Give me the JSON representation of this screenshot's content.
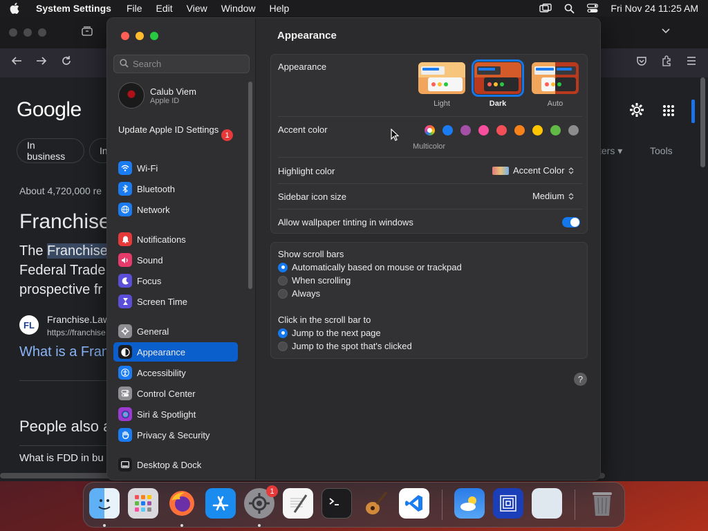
{
  "menubar": {
    "app_name": "System Settings",
    "menus": [
      "File",
      "Edit",
      "View",
      "Window",
      "Help"
    ],
    "datetime": "Fri Nov 24  11:25 AM"
  },
  "browser": {
    "logo": "Google",
    "chips": [
      "In business",
      "In"
    ],
    "filters_label": "ters",
    "tools_label": "Tools",
    "results_count": "About 4,720,000 re",
    "heading": "Franchise",
    "para_line1_prefix": "The ",
    "para_line1_highlight": "Franchise",
    "para_line2": "Federal Trade",
    "para_line3": "prospective fr",
    "favicon_text": "FL",
    "site_name": "Franchise.Law",
    "site_url": "https://franchise",
    "result_link": "What is a Fran",
    "people_also": "People also a",
    "question": "What is FDD in bu"
  },
  "sidebar": {
    "search_placeholder": "Search",
    "profile_name": "Calub Viem",
    "profile_sub": "Apple ID",
    "update_label": "Update Apple ID Settings",
    "update_badge": "1",
    "items": [
      {
        "label": "Wi-Fi",
        "icon": "wifi-icon",
        "color": "#1a7cf0"
      },
      {
        "label": "Bluetooth",
        "icon": "bluetooth-icon",
        "color": "#1a7cf0"
      },
      {
        "label": "Network",
        "icon": "globe-icon",
        "color": "#1a7cf0"
      },
      {
        "label": "Notifications",
        "icon": "bell-icon",
        "color": "#e5393a"
      },
      {
        "label": "Sound",
        "icon": "speaker-icon",
        "color": "#e53a6a"
      },
      {
        "label": "Focus",
        "icon": "moon-icon",
        "color": "#5a4fd6"
      },
      {
        "label": "Screen Time",
        "icon": "hourglass-icon",
        "color": "#5a4fd6"
      },
      {
        "label": "General",
        "icon": "gear-icon",
        "color": "#8e8e93"
      },
      {
        "label": "Appearance",
        "icon": "appearance-icon",
        "color": "#1c1c1e"
      },
      {
        "label": "Accessibility",
        "icon": "accessibility-icon",
        "color": "#1a7cf0"
      },
      {
        "label": "Control Center",
        "icon": "toggles-icon",
        "color": "#8e8e93"
      },
      {
        "label": "Siri & Spotlight",
        "icon": "siri-icon",
        "color": "#9b3bd1"
      },
      {
        "label": "Privacy & Security",
        "icon": "hand-icon",
        "color": "#1a7cf0"
      },
      {
        "label": "Desktop & Dock",
        "icon": "dock-icon",
        "color": "#1c1c1e"
      }
    ]
  },
  "content": {
    "title": "Appearance",
    "appearance_label": "Appearance",
    "modes": [
      "Light",
      "Dark",
      "Auto"
    ],
    "selected_mode": "Dark",
    "accent_label": "Accent color",
    "accent_colors": [
      "#1a7cf0",
      "#a550a7",
      "#f74f9e",
      "#f25056",
      "#f7821b",
      "#ffc600",
      "#62ba46",
      "#8c8c8c"
    ],
    "multicolor_label": "Multicolor",
    "highlight_label": "Highlight color",
    "highlight_value": "Accent Color",
    "icon_size_label": "Sidebar icon size",
    "icon_size_value": "Medium",
    "tinting_label": "Allow wallpaper tinting in windows",
    "tinting_on": true,
    "scrollbars_label": "Show scroll bars",
    "scrollbar_options": [
      "Automatically based on mouse or trackpad",
      "When scrolling",
      "Always"
    ],
    "click_label": "Click in the scroll bar to",
    "click_options": [
      "Jump to the next page",
      "Jump to the spot that's clicked"
    ],
    "help": "?"
  },
  "dock": {
    "apps": [
      "finder-icon",
      "launchpad-icon",
      "firefox-icon",
      "app-store-icon",
      "system-settings-icon",
      "textedit-icon",
      "terminal-icon",
      "garageband-icon",
      "vscode-icon",
      "weather-icon",
      "screen-sharing-icon",
      "preview-icon",
      "trash-icon"
    ],
    "settings_badge": "1"
  }
}
